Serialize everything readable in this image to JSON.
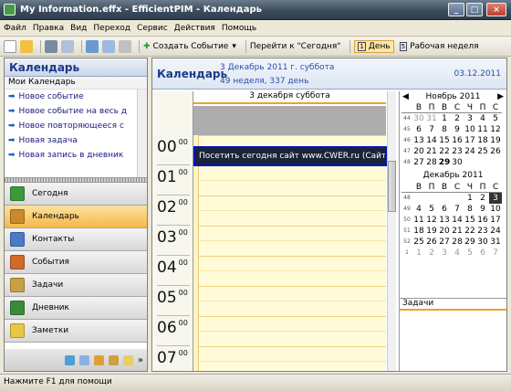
{
  "window": {
    "title": "My Information.effx - EfficientPIM - Календарь",
    "min": "_",
    "max": "□",
    "close": "×"
  },
  "menu": [
    "Файл",
    "Правка",
    "Вид",
    "Переход",
    "Сервис",
    "Действия",
    "Помощь"
  ],
  "toolbar": {
    "new_event": "Создать Событие",
    "goto_today": "Перейти к \"Сегодня\"",
    "day": "День",
    "work_week": "Рабочая неделя",
    "day_num": "1",
    "week_num": "5"
  },
  "sidebar": {
    "title": "Календарь",
    "subheader": "Мои Календарь",
    "commands": [
      "Новое событие",
      "Новое событие на весь д",
      "Новое повторяющееся с",
      "Новая задача",
      "Новая запись в дневник"
    ],
    "nav": [
      {
        "label": "Сегодня",
        "color": "#3a9a3a"
      },
      {
        "label": "Календарь",
        "color": "#c88a2a"
      },
      {
        "label": "Контакты",
        "color": "#4a7ac8"
      },
      {
        "label": "События",
        "color": "#d06a2a"
      },
      {
        "label": "Задачи",
        "color": "#c8a040"
      },
      {
        "label": "Дневник",
        "color": "#3a8a3a"
      },
      {
        "label": "Заметки",
        "color": "#e8c840"
      }
    ]
  },
  "main": {
    "title": "Календарь",
    "date_line": "3 Декабрь 2011 г. суббота",
    "week_line": "49 неделя, 337 день",
    "date_short": "03.12.2011",
    "day_header": "3 декабря суббота",
    "hours": [
      "00",
      "01",
      "02",
      "03",
      "04",
      "05",
      "06",
      "07"
    ],
    "minutes": "00",
    "event": "Посетить сегодня сайт www.CWER.ru (Сайт"
  },
  "cal1": {
    "title": "Ноябрь 2011",
    "prev": "◀",
    "next": "▶",
    "dow": [
      "В",
      "П",
      "В",
      "С",
      "Ч",
      "П",
      "С"
    ],
    "weeks": [
      {
        "wk": "44",
        "days": [
          "30",
          "31",
          "1",
          "2",
          "3",
          "4",
          "5"
        ],
        "oth": [
          0,
          1
        ]
      },
      {
        "wk": "45",
        "days": [
          "6",
          "7",
          "8",
          "9",
          "10",
          "11",
          "12"
        ],
        "oth": []
      },
      {
        "wk": "46",
        "days": [
          "13",
          "14",
          "15",
          "16",
          "17",
          "18",
          "19"
        ],
        "oth": []
      },
      {
        "wk": "47",
        "days": [
          "20",
          "21",
          "22",
          "23",
          "24",
          "25",
          "26"
        ],
        "oth": []
      },
      {
        "wk": "48",
        "days": [
          "27",
          "28",
          "29",
          "30",
          "",
          "",
          ""
        ],
        "oth": [],
        "bold": [
          2
        ]
      }
    ]
  },
  "cal2": {
    "title": "Декабрь 2011",
    "dow": [
      "В",
      "П",
      "В",
      "С",
      "Ч",
      "П",
      "С"
    ],
    "weeks": [
      {
        "wk": "48",
        "days": [
          "",
          "",
          "",
          "",
          "1",
          "2",
          "3"
        ],
        "oth": [],
        "sel": 6
      },
      {
        "wk": "49",
        "days": [
          "4",
          "5",
          "6",
          "7",
          "8",
          "9",
          "10"
        ],
        "oth": []
      },
      {
        "wk": "50",
        "days": [
          "11",
          "12",
          "13",
          "14",
          "15",
          "16",
          "17"
        ],
        "oth": []
      },
      {
        "wk": "51",
        "days": [
          "18",
          "19",
          "20",
          "21",
          "22",
          "23",
          "24"
        ],
        "oth": []
      },
      {
        "wk": "52",
        "days": [
          "25",
          "26",
          "27",
          "28",
          "29",
          "30",
          "31"
        ],
        "oth": []
      },
      {
        "wk": "1",
        "days": [
          "1",
          "2",
          "3",
          "4",
          "5",
          "6",
          "7"
        ],
        "oth": [
          0,
          1,
          2,
          3,
          4,
          5,
          6
        ]
      }
    ]
  },
  "tasks": {
    "title": "Задачи"
  },
  "status": "Нажмите F1 для помощи"
}
